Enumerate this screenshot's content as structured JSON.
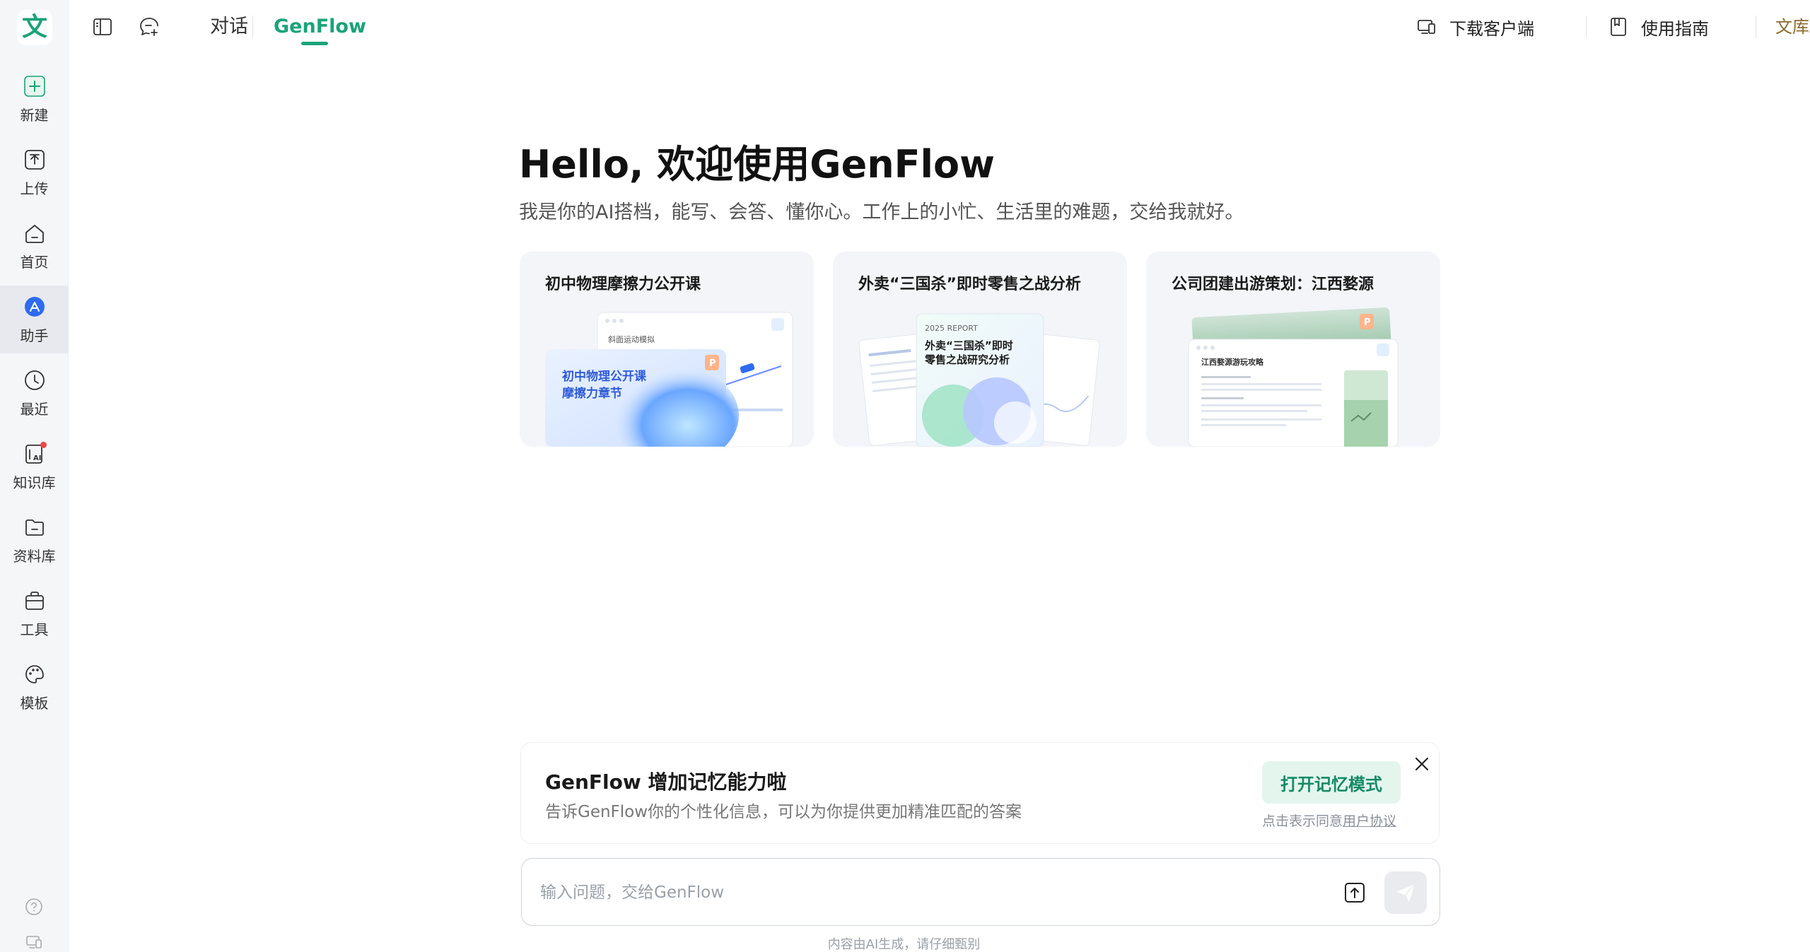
{
  "app": {
    "logo_char": "文"
  },
  "sidebar": {
    "items": [
      {
        "label": "新建",
        "icon": "plus-square-icon"
      },
      {
        "label": "上传",
        "icon": "upload-icon"
      },
      {
        "label": "首页",
        "icon": "home-icon"
      },
      {
        "label": "助手",
        "icon": "assistant-icon",
        "active": true
      },
      {
        "label": "最近",
        "icon": "clock-icon"
      },
      {
        "label": "知识库",
        "icon": "knowledge-base-icon",
        "badge": "red-dot"
      },
      {
        "label": "资料库",
        "icon": "folder-icon"
      },
      {
        "label": "工具",
        "icon": "toolbox-icon"
      },
      {
        "label": "模板",
        "icon": "palette-icon"
      }
    ],
    "bottom": [
      {
        "icon": "help-icon"
      },
      {
        "icon": "device-icon"
      }
    ]
  },
  "topbar": {
    "tabs": [
      {
        "label": "对话",
        "active": false
      },
      {
        "label": "GenFlow",
        "active": true
      }
    ],
    "download": "下载客户端",
    "guide": "使用指南",
    "vip": "文库AI实力派"
  },
  "hero": {
    "title": "Hello, 欢迎使用GenFlow",
    "subtitle": "我是你的AI搭档，能写、会答、懂你心。工作上的小忙、生活里的难题，交给我就好。"
  },
  "cards": [
    {
      "title": "初中物理摩擦力公开课",
      "thumb_label": "斜面运动模拟",
      "thumb_title_1": "初中物理公开课",
      "thumb_title_2": "摩擦力章节"
    },
    {
      "title": "外卖“三国杀”即时零售之战分析",
      "thumb_label": "2025 REPORT",
      "thumb_title_1": "外卖“三国杀”即时",
      "thumb_title_2": "零售之战研究分析"
    },
    {
      "title": "公司团建出游策划：江西婺源",
      "thumb_label": "江西婺源游玩攻略"
    }
  ],
  "memory_banner": {
    "title": "GenFlow 增加记忆能力啦",
    "description": "告诉GenFlow你的个性化信息，可以为你提供更加精准匹配的答案",
    "button": "打开记忆模式",
    "agree_prefix": "点击表示同意",
    "agree_link": "用户协议"
  },
  "input": {
    "placeholder": "输入问题，交给GenFlow"
  },
  "footer": {
    "disclaimer": "内容由AI生成，请仔细甄别"
  },
  "colors": {
    "accent": "#1aa37a",
    "vip": "#8a6a2e",
    "badge": "#f04848"
  }
}
